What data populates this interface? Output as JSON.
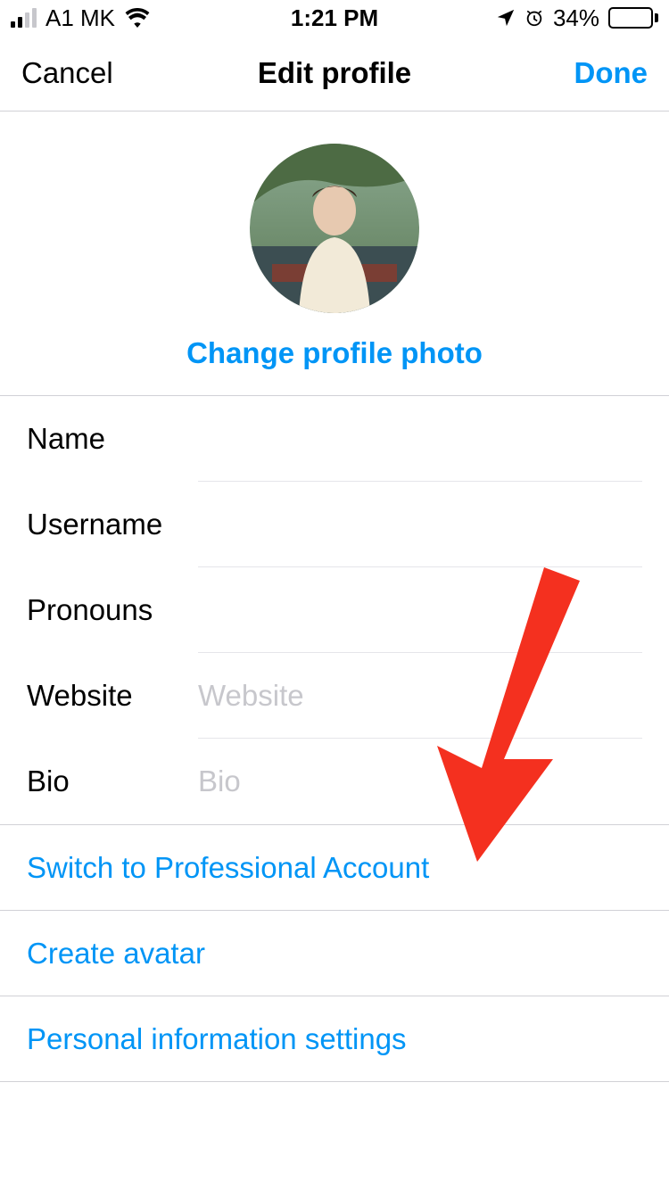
{
  "status": {
    "carrier": "A1 MK",
    "time": "1:21 PM",
    "battery_pct": "34%"
  },
  "nav": {
    "cancel": "Cancel",
    "title": "Edit profile",
    "done": "Done"
  },
  "photo": {
    "change_label": "Change profile photo"
  },
  "fields": {
    "name": {
      "label": "Name",
      "value": "",
      "placeholder": ""
    },
    "username": {
      "label": "Username",
      "value": "",
      "placeholder": ""
    },
    "pronouns": {
      "label": "Pronouns",
      "value": "",
      "placeholder": ""
    },
    "website": {
      "label": "Website",
      "value": "",
      "placeholder": "Website"
    },
    "bio": {
      "label": "Bio",
      "value": "",
      "placeholder": "Bio"
    }
  },
  "links": {
    "switch_pro": "Switch to Professional Account",
    "create_avatar": "Create avatar",
    "personal_info": "Personal information settings"
  }
}
